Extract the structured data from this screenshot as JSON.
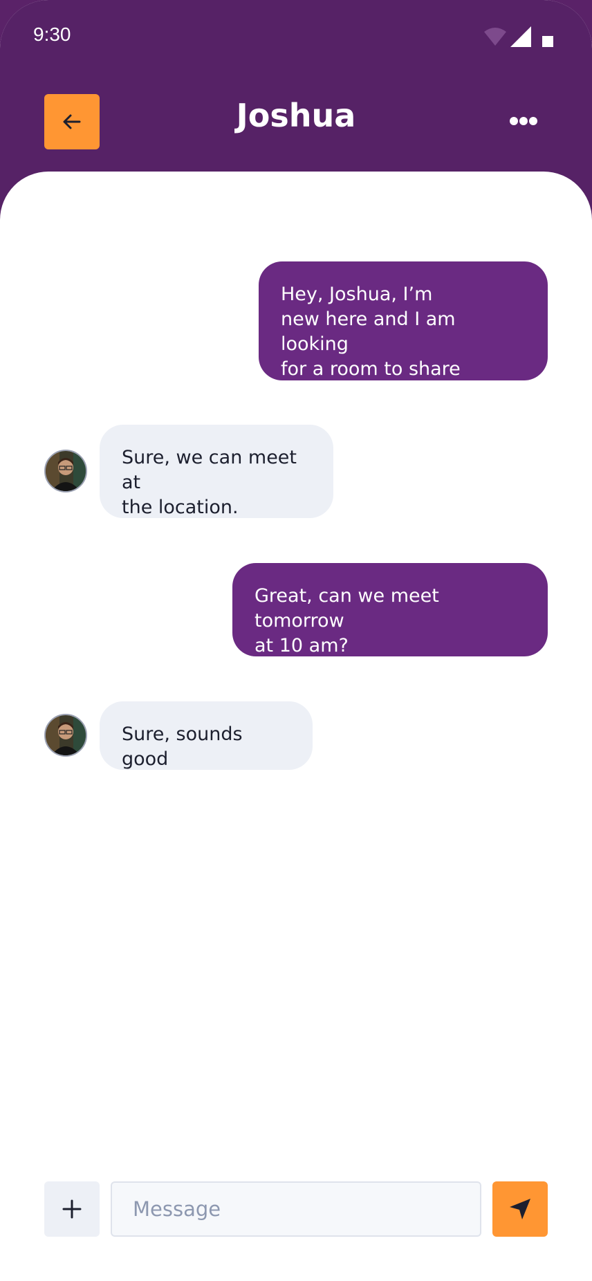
{
  "status_bar": {
    "time": "9:30"
  },
  "header": {
    "title": "Joshua"
  },
  "messages": [
    {
      "direction": "sent",
      "text": "Hey, Joshua, I’m\nnew here and I am looking\nfor a room to share"
    },
    {
      "direction": "received",
      "text": "Sure, we can meet at\nthe location."
    },
    {
      "direction": "sent",
      "text": "Great, can we meet tomorrow\nat 10 am?"
    },
    {
      "direction": "received",
      "text": "Sure, sounds good"
    }
  ],
  "composer": {
    "placeholder": "Message",
    "value": ""
  },
  "colors": {
    "header_bg": "#562266",
    "sent_bubble": "#6a2a82",
    "received_bubble": "#edf0f6",
    "accent": "#ff9633"
  },
  "icons": {
    "back": "arrow-left-icon",
    "more": "ellipsis-icon",
    "add": "plus-icon",
    "send": "send-arrow-icon",
    "wifi": "wifi-icon",
    "signal": "signal-icon",
    "battery": "battery-icon"
  }
}
